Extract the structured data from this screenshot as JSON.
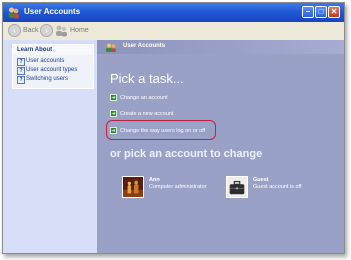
{
  "window": {
    "title": "User Accounts",
    "buttons": {
      "minimize": "–",
      "maximize": "□",
      "close": "✕"
    }
  },
  "toolbar": {
    "back_label": "Back",
    "forward_label": "",
    "home_label": "Home"
  },
  "sidebar": {
    "panel_title": "Learn About",
    "items": [
      {
        "label": "User accounts",
        "icon": "help-icon"
      },
      {
        "label": "User account types",
        "icon": "help-icon"
      },
      {
        "label": "Switching users",
        "icon": "help-icon"
      }
    ]
  },
  "main": {
    "header_title": "User Accounts",
    "pick_task_title": "Pick a task...",
    "tasks": [
      {
        "label": "Change an account",
        "icon": "green-arrow-icon"
      },
      {
        "label": "Create a new account",
        "icon": "green-arrow-icon"
      },
      {
        "label": "Change the way users log on or off",
        "icon": "green-arrow-icon",
        "highlighted": true
      }
    ],
    "pick_account_title": "or pick an account to change",
    "accounts": [
      {
        "name": "Ann",
        "description": "Computer administrator",
        "picture": "chess-picture"
      },
      {
        "name": "Guest",
        "description": "Guest account is off",
        "picture": "briefcase-picture"
      }
    ]
  },
  "colors": {
    "titlebar": "#2159d5",
    "sidebar_bg": "#d6dff7",
    "main_bg": "#9aa1c6",
    "highlight_ring": "#c3213d"
  }
}
